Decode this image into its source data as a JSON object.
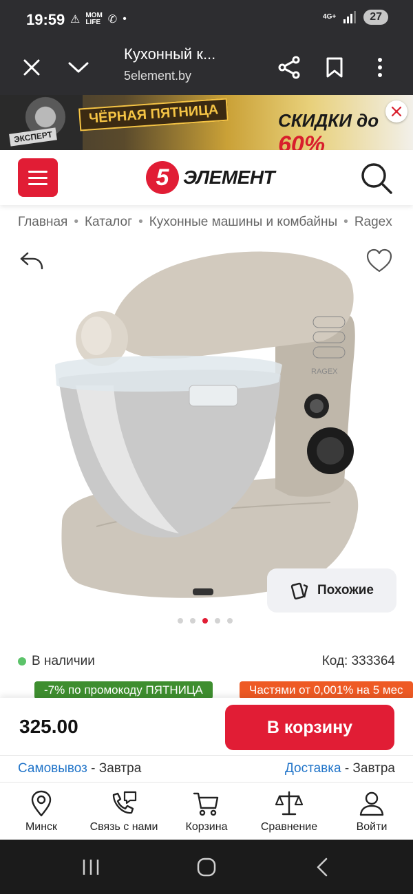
{
  "status_bar": {
    "time": "19:59",
    "notif_icons": [
      "warning-icon",
      "mom-life-icon",
      "viber-icon",
      "dot-icon"
    ],
    "network": "4G+",
    "battery": "27"
  },
  "browser": {
    "title": "Кухонный к...",
    "url": "5element.by"
  },
  "banner": {
    "tag": "ЭКСПЕРТ",
    "headline": "ЧЁРНАЯ ПЯТНИЦА",
    "sale_prefix": "СКИДКИ до ",
    "sale_value": "60%"
  },
  "header": {
    "logo_digit": "5",
    "logo_text": "ЭЛЕМЕНТ",
    "brand_color": "#e11d35"
  },
  "breadcrumbs": [
    "Главная",
    "Каталог",
    "Кухонные машины и комбайны",
    "Ragex"
  ],
  "gallery": {
    "brand_on_product": "RAGEX",
    "dots_total": 5,
    "dots_active_index": 2,
    "similar_label": "Похожие"
  },
  "product": {
    "availability": "В наличии",
    "code": "Код: 333364",
    "promo_badge": "-7% по промокоду ПЯТНИЦА",
    "parts_badge": "Частями от 0,001% на 5 мес",
    "price": "325.00",
    "cart_button": "В корзину"
  },
  "delivery": {
    "pickup_link": "Самовывоз",
    "pickup_when": " - Завтра",
    "delivery_link": "Доставка",
    "delivery_when": " - Завтра"
  },
  "bottom_nav": [
    {
      "label": "Минск",
      "icon": "location-pin-icon"
    },
    {
      "label": "Связь с нами",
      "icon": "phone-chat-icon"
    },
    {
      "label": "Корзина",
      "icon": "cart-icon"
    },
    {
      "label": "Сравнение",
      "icon": "scales-icon"
    },
    {
      "label": "Войти",
      "icon": "user-icon"
    }
  ]
}
